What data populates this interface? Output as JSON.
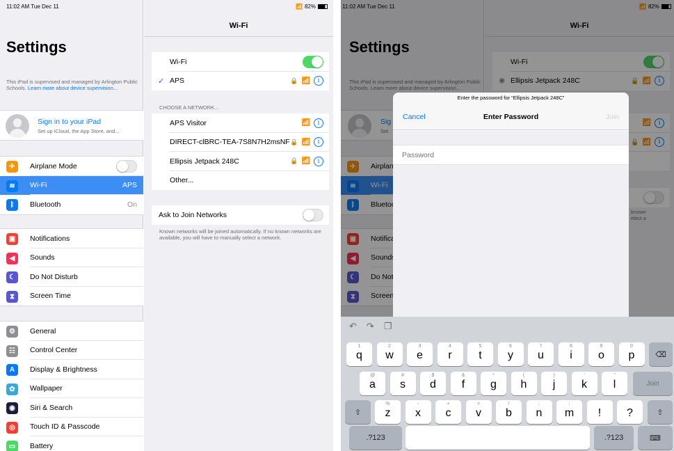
{
  "status": {
    "time_date": "11:02 AM  Tue Dec 11",
    "battery": "82%",
    "wifi_icon": "wifi-icon"
  },
  "master": {
    "title": "Settings",
    "supervised_text": "This iPad is supervised and managed by Arlington Public Schools.",
    "supervised_link": "Learn more about device supervision...",
    "sign_in_title": "Sign in to your iPad",
    "sign_in_sub": "Set up iCloud, the App Store, and...",
    "group1": [
      {
        "label": "Airplane Mode",
        "icon": "airplane-icon",
        "color": "#ff9500",
        "toggle": false
      },
      {
        "label": "Wi-Fi",
        "icon": "wifi-icon",
        "color": "#007aff",
        "value": "APS",
        "selected": true
      },
      {
        "label": "Bluetooth",
        "icon": "bluetooth-icon",
        "color": "#007aff",
        "value": "On"
      }
    ],
    "group2": [
      {
        "label": "Notifications",
        "icon": "notifications-icon",
        "color": "#ff3b30"
      },
      {
        "label": "Sounds",
        "icon": "sounds-icon",
        "color": "#ff2d55"
      },
      {
        "label": "Do Not Disturb",
        "icon": "moon-icon",
        "color": "#5856d6"
      },
      {
        "label": "Screen Time",
        "icon": "hourglass-icon",
        "color": "#5856d6"
      }
    ],
    "group3": [
      {
        "label": "General",
        "icon": "gear-icon",
        "color": "#8e8e93"
      },
      {
        "label": "Control Center",
        "icon": "control-center-icon",
        "color": "#8e8e93"
      },
      {
        "label": "Display & Brightness",
        "icon": "display-icon",
        "color": "#007aff"
      },
      {
        "label": "Wallpaper",
        "icon": "wallpaper-icon",
        "color": "#34aadc"
      },
      {
        "label": "Siri & Search",
        "icon": "siri-icon",
        "color": "#1c1c3c"
      },
      {
        "label": "Touch ID & Passcode",
        "icon": "fingerprint-icon",
        "color": "#ff3b30"
      },
      {
        "label": "Battery",
        "icon": "battery-icon",
        "color": "#4cd964"
      }
    ]
  },
  "detail": {
    "nav_title": "Wi-Fi",
    "wifi_label": "Wi-Fi",
    "wifi_on": true,
    "connected_network": "APS",
    "choose_header": "CHOOSE A NETWORK...",
    "networks": [
      {
        "name": "APS Visitor",
        "locked": false
      },
      {
        "name": "DIRECT-clBRC-TEA-7S8N7H2msNF",
        "locked": true
      },
      {
        "name": "Ellipsis Jetpack 248C",
        "locked": true
      },
      {
        "name": "Other...",
        "locked": false,
        "other": true
      }
    ],
    "ask_label": "Ask to Join Networks",
    "ask_on": false,
    "ask_note": "Known networks will be joined automatically. If no known networks are available, you will have to manually select a network."
  },
  "right_bg": {
    "connecting_network": "Ellipsis Jetpack 248C",
    "partial_labels": [
      "Sig",
      "Set",
      "Airplan",
      "Wi-Fi",
      "Bluetoo",
      "Notifica",
      "Sounds",
      "Do Not",
      "Screen"
    ],
    "partial_note": [
      "known",
      "elect a"
    ]
  },
  "modal": {
    "prompt": "Enter the password for “Ellipsis Jetpack 248C”",
    "cancel": "Cancel",
    "title": "Enter Password",
    "join": "Join",
    "password_placeholder": "Password"
  },
  "keyboard": {
    "row1": [
      {
        "k": "q",
        "a": "1"
      },
      {
        "k": "w",
        "a": "2"
      },
      {
        "k": "e",
        "a": "3"
      },
      {
        "k": "r",
        "a": "4"
      },
      {
        "k": "t",
        "a": "5"
      },
      {
        "k": "y",
        "a": "6"
      },
      {
        "k": "u",
        "a": "7"
      },
      {
        "k": "i",
        "a": "8"
      },
      {
        "k": "o",
        "a": "9"
      },
      {
        "k": "p",
        "a": "0"
      }
    ],
    "row2": [
      {
        "k": "a",
        "a": "@"
      },
      {
        "k": "s",
        "a": "#"
      },
      {
        "k": "d",
        "a": "$"
      },
      {
        "k": "f",
        "a": "&"
      },
      {
        "k": "g",
        "a": "*"
      },
      {
        "k": "h",
        "a": "("
      },
      {
        "k": "j",
        "a": ")"
      },
      {
        "k": "k",
        "a": "'"
      },
      {
        "k": "l",
        "a": "\""
      }
    ],
    "row3": [
      {
        "k": "z",
        "a": "%"
      },
      {
        "k": "x",
        "a": "-"
      },
      {
        "k": "c",
        "a": "+"
      },
      {
        "k": "v",
        "a": "="
      },
      {
        "k": "b",
        "a": "/"
      },
      {
        "k": "n",
        "a": ";"
      },
      {
        "k": "m",
        "a": ":"
      },
      {
        "k": "!",
        "a": ""
      },
      {
        "k": "?",
        "a": ""
      }
    ],
    "join_key": "Join",
    "num_key": ".?123",
    "tools": [
      "undo-icon",
      "redo-icon",
      "paste-icon"
    ]
  }
}
